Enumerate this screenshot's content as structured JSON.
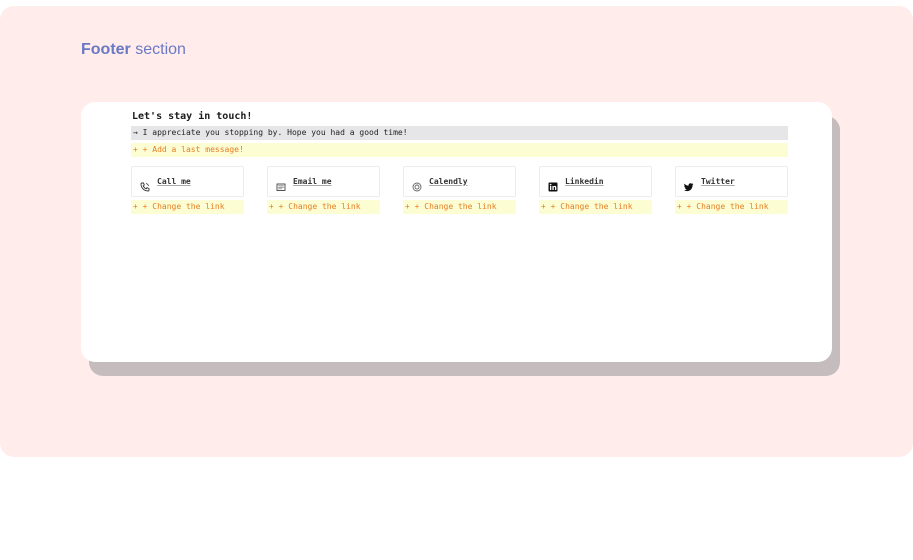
{
  "section": {
    "title_bold": "Footer",
    "title_rest": " section"
  },
  "footer": {
    "heading": "Let's stay in touch!",
    "message": "→ I appreciate you stopping by. Hope you had a good time!",
    "add_message": "+ + Add a last message!",
    "links": [
      {
        "label": "Call me",
        "icon": "phone-icon",
        "change": "+ + Change the link"
      },
      {
        "label": "Email me",
        "icon": "mail-icon",
        "change": "+ + Change the link"
      },
      {
        "label": "Calendly",
        "icon": "calendly-icon",
        "change": "+ + Change the link"
      },
      {
        "label": "Linkedin",
        "icon": "linkedin-icon",
        "change": "+ + Change the link"
      },
      {
        "label": "Twitter",
        "icon": "twitter-icon",
        "change": "+ + Change the link"
      }
    ]
  },
  "colors": {
    "background": "#ffeceb",
    "title": "#6a79c6",
    "accent": "#e67e22",
    "highlight": "#fdfdd4"
  }
}
